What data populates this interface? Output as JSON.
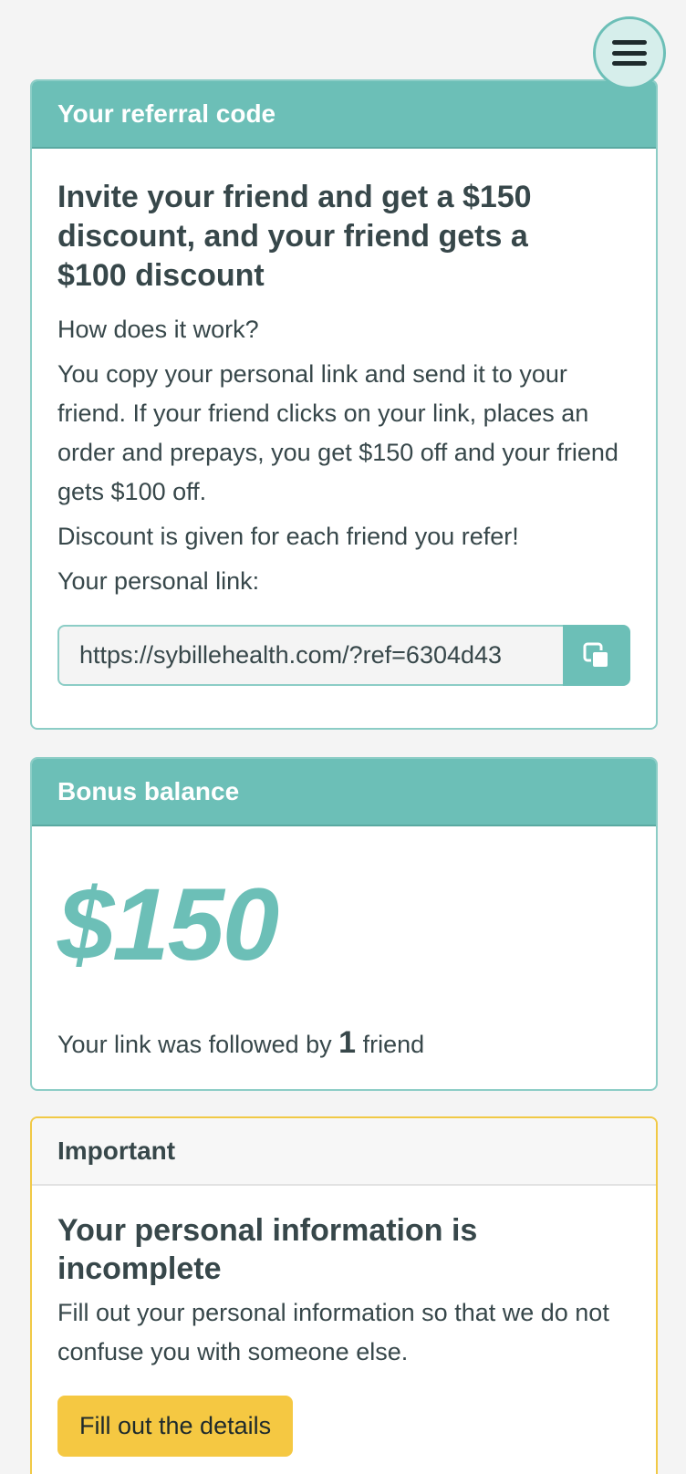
{
  "menu": {
    "icon": "hamburger-menu-icon"
  },
  "referral": {
    "header": "Your referral code",
    "title": "Invite your friend and get a $150 discount, and your friend gets a $100 discount",
    "how_label": "How does it work?",
    "explanation": "You copy your personal link and send it to your friend. If your friend clicks on your link, places an order and prepays, you get $150 off and your friend gets $100 off.",
    "discount_note": "Discount is given for each friend you refer!",
    "link_label": "Your personal link:",
    "link_value": "https://sybillehealth.com/?ref=6304d43",
    "copy_icon": "copy-icon"
  },
  "bonus": {
    "header": "Bonus balance",
    "amount": "$150",
    "followed_prefix": "Your link was followed by ",
    "followed_count": "1",
    "followed_suffix": " friend"
  },
  "important": {
    "header": "Important",
    "title": "Your personal information is incomplete",
    "text": "Fill out your personal information so that we do not confuse you with someone else.",
    "button_label": "Fill out the details"
  },
  "colors": {
    "accent": "#6cbfb7",
    "warning_border": "#f1c946",
    "warning_button": "#f5c842",
    "text": "#37474a"
  }
}
